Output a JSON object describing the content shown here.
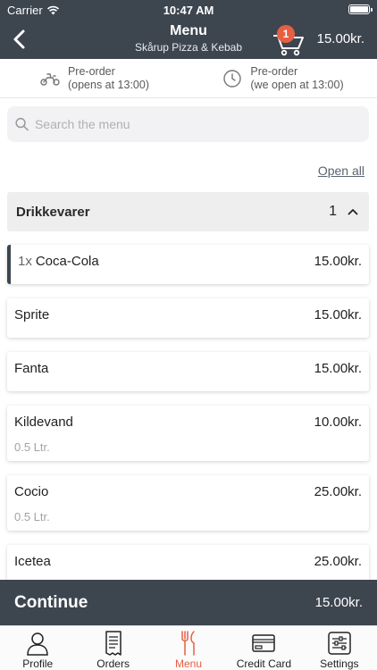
{
  "status_bar": {
    "carrier": "Carrier",
    "time": "10:47 AM"
  },
  "header": {
    "title": "Menu",
    "subtitle": "Skårup Pizza & Kebab",
    "cart_count": "1",
    "cart_total": "15.00kr."
  },
  "preorder": {
    "delivery": {
      "line1": "Pre-order",
      "line2": "(opens at 13:00)",
      "icon": "scooter-icon"
    },
    "pickup": {
      "line1": "Pre-order",
      "line2": "(we open at 13:00)",
      "icon": "clock-icon"
    }
  },
  "search": {
    "placeholder": "Search the menu"
  },
  "open_all": "Open all",
  "category": {
    "name": "Drikkevarer",
    "count": "1"
  },
  "items": [
    {
      "qty": "1x",
      "name": "Coca-Cola",
      "price": "15.00kr.",
      "desc": ""
    },
    {
      "qty": "",
      "name": "Sprite",
      "price": "15.00kr.",
      "desc": ""
    },
    {
      "qty": "",
      "name": "Fanta",
      "price": "15.00kr.",
      "desc": ""
    },
    {
      "qty": "",
      "name": "Kildevand",
      "price": "10.00kr.",
      "desc": "0.5 Ltr."
    },
    {
      "qty": "",
      "name": "Cocio",
      "price": "25.00kr.",
      "desc": "0.5 Ltr."
    },
    {
      "qty": "",
      "name": "Icetea",
      "price": "25.00kr.",
      "desc": ""
    }
  ],
  "continue": {
    "label": "Continue",
    "amount": "15.00kr."
  },
  "tabs": [
    {
      "label": "Profile",
      "icon": "person-icon"
    },
    {
      "label": "Orders",
      "icon": "receipt-icon"
    },
    {
      "label": "Menu",
      "icon": "fork-knife-icon"
    },
    {
      "label": "Credit Card",
      "icon": "credit-card-icon"
    },
    {
      "label": "Settings",
      "icon": "sliders-icon"
    }
  ],
  "colors": {
    "header": "#3d454f",
    "accent": "#e65f43",
    "category_bg": "#eeeeef"
  }
}
